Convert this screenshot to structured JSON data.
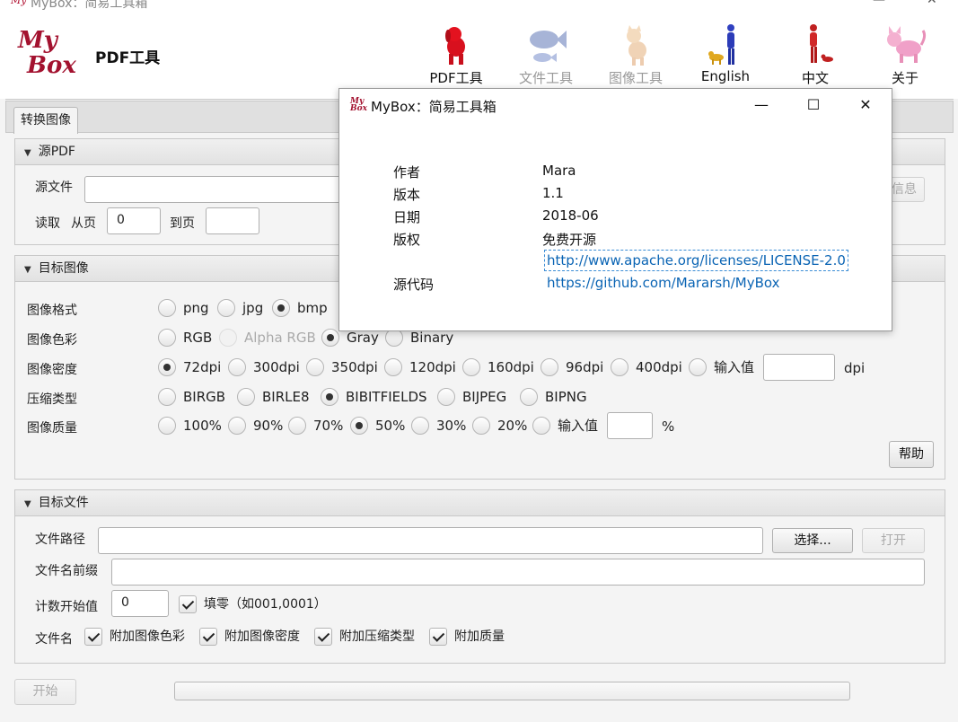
{
  "window": {
    "title": "MyBox：简易工具箱",
    "min_icon": "minimize-icon",
    "close_icon": "close-icon"
  },
  "header": {
    "logo_line1": "My",
    "logo_line2": "Box",
    "app_title": "PDF工具",
    "nav": [
      {
        "label": "PDF工具",
        "icon": "red-dog-icon",
        "enabled": true
      },
      {
        "label": "文件工具",
        "icon": "fish-icon",
        "enabled": false
      },
      {
        "label": "图像工具",
        "icon": "cat-icon",
        "enabled": false
      },
      {
        "label": "English",
        "icon": "person-with-dog-icon",
        "enabled": true
      },
      {
        "label": "中文",
        "icon": "person-red-icon",
        "enabled": true
      },
      {
        "label": "关于",
        "icon": "pink-cat-icon",
        "enabled": true
      }
    ]
  },
  "tabs": [
    {
      "label": "转换图像",
      "active": true
    }
  ],
  "source": {
    "title": "源PDF",
    "file_label": "源文件",
    "file_value": "",
    "info_button": "信息",
    "read_label": "读取",
    "from_label": "从页",
    "from_value": "0",
    "to_label": "到页",
    "to_value": ""
  },
  "target_image": {
    "title": "目标图像",
    "format": {
      "label": "图像格式",
      "options": [
        "png",
        "jpg",
        "bmp"
      ],
      "selected": "bmp"
    },
    "color": {
      "label": "图像色彩",
      "options": [
        "RGB",
        "Alpha RGB",
        "Gray",
        "Binary"
      ],
      "selected": "Gray",
      "disabled": [
        "Alpha RGB"
      ]
    },
    "density": {
      "label": "图像密度",
      "options": [
        "72dpi",
        "300dpi",
        "350dpi",
        "120dpi",
        "160dpi",
        "96dpi",
        "400dpi",
        "输入值"
      ],
      "selected": "72dpi",
      "input_value": "",
      "unit": "dpi"
    },
    "compression": {
      "label": "压缩类型",
      "options": [
        "BIRGB",
        "BIRLE8",
        "BIBITFIELDS",
        "BIJPEG",
        "BIPNG"
      ],
      "selected": "BIBITFIELDS"
    },
    "quality": {
      "label": "图像质量",
      "options": [
        "100%",
        "90%",
        "70%",
        "50%",
        "30%",
        "20%",
        "输入值"
      ],
      "selected": "50%",
      "input_value": "",
      "unit": "%"
    },
    "help_button": "帮助"
  },
  "target_file": {
    "title": "目标文件",
    "path_label": "文件路径",
    "path_value": "",
    "choose_button": "选择...",
    "open_button": "打开",
    "prefix_label": "文件名前缀",
    "prefix_value": "",
    "counter_label": "计数开始值",
    "counter_value": "0",
    "pad_zero_label": "填零（如001,0001）",
    "pad_zero_checked": true,
    "filename_label": "文件名",
    "append": [
      {
        "label": "附加图像色彩",
        "checked": true
      },
      {
        "label": "附加图像密度",
        "checked": true
      },
      {
        "label": "附加压缩类型",
        "checked": true
      },
      {
        "label": "附加质量",
        "checked": true
      }
    ]
  },
  "footer": {
    "start_button": "开始",
    "progress": 0
  },
  "about_dialog": {
    "title": "MyBox：简易工具箱",
    "icon_text": "My Box",
    "minimize_icon": "minimize-icon",
    "maximize_icon": "maximize-icon",
    "close_icon": "close-icon",
    "rows": [
      {
        "key": "作者",
        "value": "Mara"
      },
      {
        "key": "版本",
        "value": "1.1"
      },
      {
        "key": "日期",
        "value": "2018-06"
      },
      {
        "key": "版权",
        "value": "免费开源"
      }
    ],
    "license_link": "http://www.apache.org/licenses/LICENSE-2.0",
    "source_key": "源代码",
    "source_link": "https://github.com/Mararsh/MyBox"
  }
}
